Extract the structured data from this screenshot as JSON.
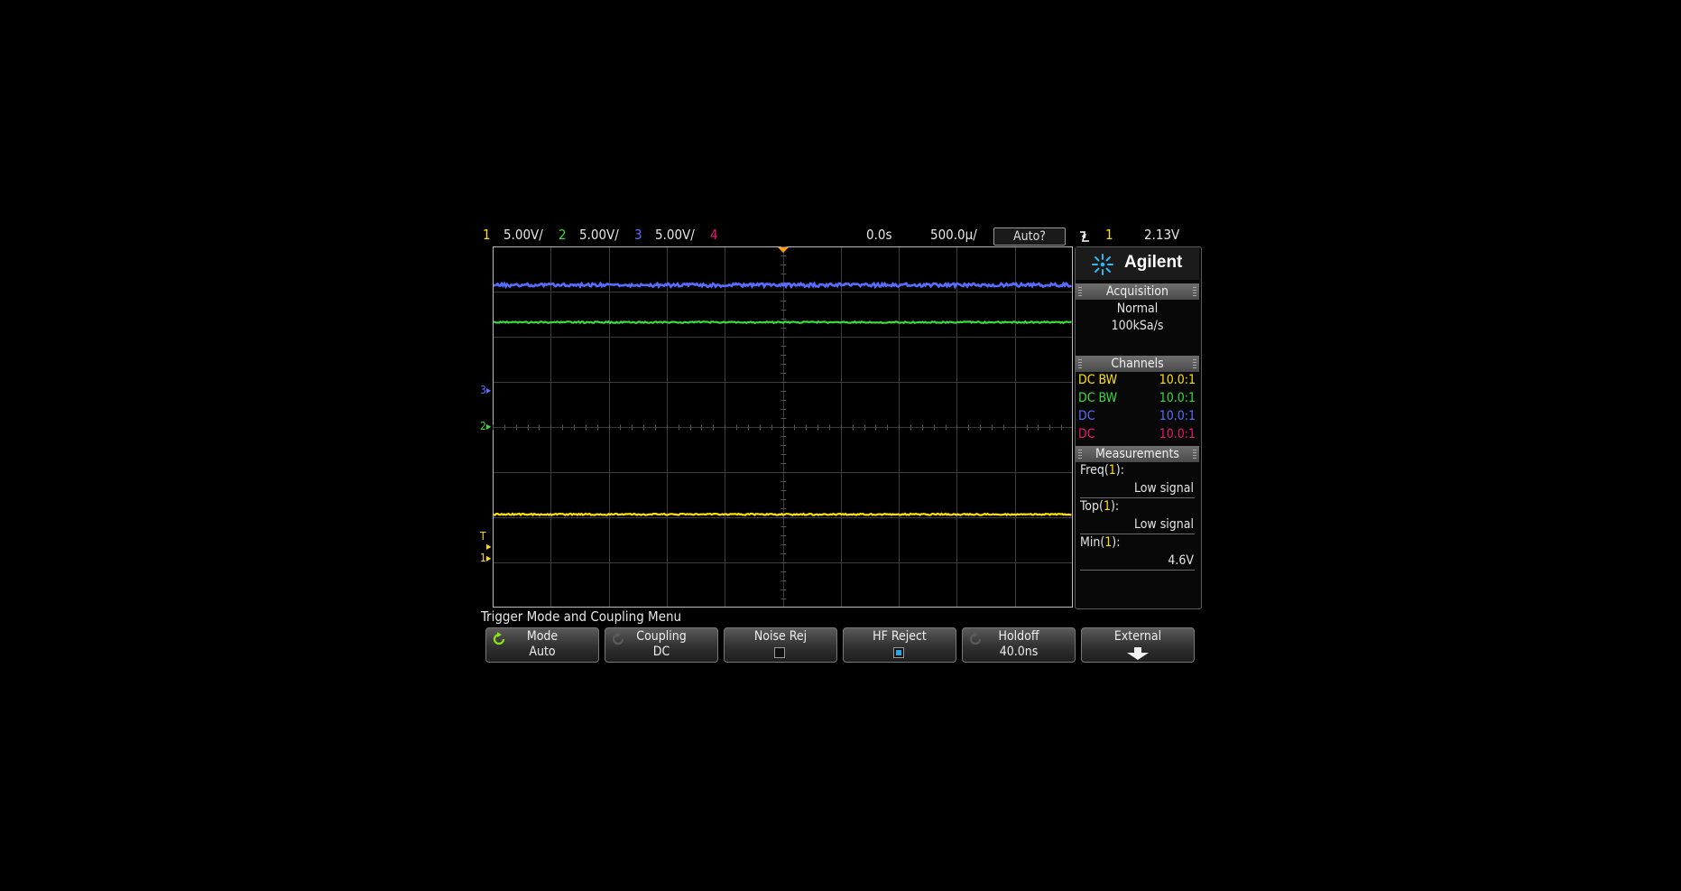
{
  "colors": {
    "ch1": "#ffe000",
    "ch2": "#3cdc3c",
    "ch3": "#5a6cff",
    "ch4": "#e8196e",
    "grid": "#3c3c3c",
    "trigger_marker": "#ff9c1a",
    "checkbox_on": "#23a8e6"
  },
  "top_bar": {
    "channels": [
      {
        "num": "1",
        "scale": "5.00V/"
      },
      {
        "num": "2",
        "scale": "5.00V/"
      },
      {
        "num": "3",
        "scale": "5.00V/"
      },
      {
        "num": "4",
        "scale": ""
      }
    ],
    "time_delay": "0.0s",
    "time_scale": "500.0µ/",
    "run_state": "Auto?",
    "trigger_slope_icon": "falling-edge-icon",
    "trigger_source": "1",
    "trigger_level": "2.13V"
  },
  "screen": {
    "traces": [
      {
        "channel": "3",
        "level_fraction": 0.107,
        "noise": "high"
      },
      {
        "channel": "2",
        "level_fraction": 0.21,
        "noise": "low"
      },
      {
        "channel": "1",
        "level_fraction": 0.742,
        "noise": "low"
      }
    ],
    "ground_markers": [
      {
        "label": "3",
        "level_fraction": 0.4
      },
      {
        "label": "2",
        "level_fraction": 0.5
      },
      {
        "label": "T",
        "level_fraction": 0.805
      },
      {
        "label": "1",
        "level_fraction": 0.865
      }
    ]
  },
  "panel": {
    "logo": "Agilent",
    "acquisition": {
      "header": "Acquisition",
      "mode": "Normal",
      "rate": "100kSa/s"
    },
    "channels": {
      "header": "Channels",
      "rows": [
        {
          "coupling": "DC BW",
          "probe": "10.0:1"
        },
        {
          "coupling": "DC BW",
          "probe": "10.0:1"
        },
        {
          "coupling": "DC",
          "probe": "10.0:1"
        },
        {
          "coupling": "DC",
          "probe": "10.0:1"
        }
      ]
    },
    "measurements": {
      "header": "Measurements",
      "items": [
        {
          "name": "Freq",
          "src": "1",
          "value": "Low signal"
        },
        {
          "name": "Top",
          "src": "1",
          "value": "Low signal"
        },
        {
          "name": "Min",
          "src": "1",
          "value": "4.6V"
        }
      ]
    }
  },
  "menu_title": "Trigger Mode and Coupling Menu",
  "softkeys": [
    {
      "label": "Mode",
      "value": "Auto"
    },
    {
      "label": "Coupling",
      "value": "DC"
    },
    {
      "label": "Noise Rej",
      "checked": false
    },
    {
      "label": "HF Reject",
      "checked": true
    },
    {
      "label": "Holdoff",
      "value": "40.0ns"
    },
    {
      "label": "External"
    }
  ]
}
